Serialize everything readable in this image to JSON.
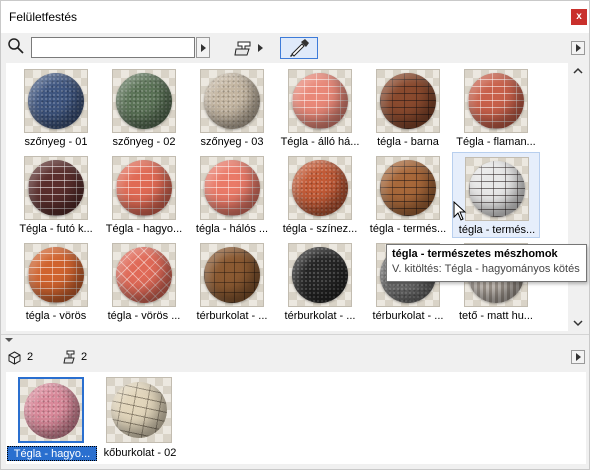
{
  "window": {
    "title": "Felületfestés",
    "close_label": "x"
  },
  "toolbar": {
    "search_value": "",
    "search_placeholder": ""
  },
  "materials": [
    {
      "label": "szőnyeg - 01",
      "color": "#3f5680",
      "texture": "speck"
    },
    {
      "label": "szőnyeg - 02",
      "color": "#5c7458",
      "texture": "speck"
    },
    {
      "label": "szőnyeg - 03",
      "color": "#c4b6a2",
      "texture": "speck"
    },
    {
      "label": "Tégla - álló há...",
      "color": "#e98878",
      "texture": "brick"
    },
    {
      "label": "tégla - barna",
      "color": "#8a4a2e",
      "texture": "brick-dark"
    },
    {
      "label": "Tégla - flaman...",
      "color": "#c8604a",
      "texture": "brick"
    },
    {
      "label": "Tégla - futó k...",
      "color": "#5a2e2c",
      "texture": "brick"
    },
    {
      "label": "Tégla - hagyo...",
      "color": "#e06a54",
      "texture": "brick"
    },
    {
      "label": "tégla - hálós ...",
      "color": "#ea7a68",
      "texture": "brick"
    },
    {
      "label": "tégla - színez...",
      "color": "#c25a36",
      "texture": "speck"
    },
    {
      "label": "tégla - termés...",
      "color": "#a8683a",
      "texture": "brick-dark"
    },
    {
      "label": "tégla - termés...",
      "color": "#e8e8e8",
      "texture": "brick-dark",
      "selected": true
    },
    {
      "label": "tégla - vörös",
      "color": "#d0632e",
      "texture": "brick"
    },
    {
      "label": "tégla - vörös ...",
      "color": "#e06a58",
      "texture": "herring"
    },
    {
      "label": "térburkolat - ...",
      "color": "#8b5a32",
      "texture": "cobble"
    },
    {
      "label": "térburkolat - ...",
      "color": "#262626",
      "texture": "speck"
    },
    {
      "label": "térburkolat - ...",
      "color": "#6e6e6e",
      "texture": "speck"
    },
    {
      "label": "tető - matt hu...",
      "color": "#b8aea4",
      "texture": "flute"
    }
  ],
  "tooltip": {
    "title": "tégla - természetes mészhomok",
    "subtitle": "V. kitöltés: Tégla - hagyományos kötés"
  },
  "bottom": {
    "element_count": "2",
    "brush_count": "2",
    "items": [
      {
        "label": "Tégla - hagyo...",
        "color": "#d9899a",
        "texture": "speck",
        "selected": true
      },
      {
        "label": "kőburkolat - 02",
        "color": "#e2d6bc",
        "texture": "stone"
      }
    ]
  }
}
